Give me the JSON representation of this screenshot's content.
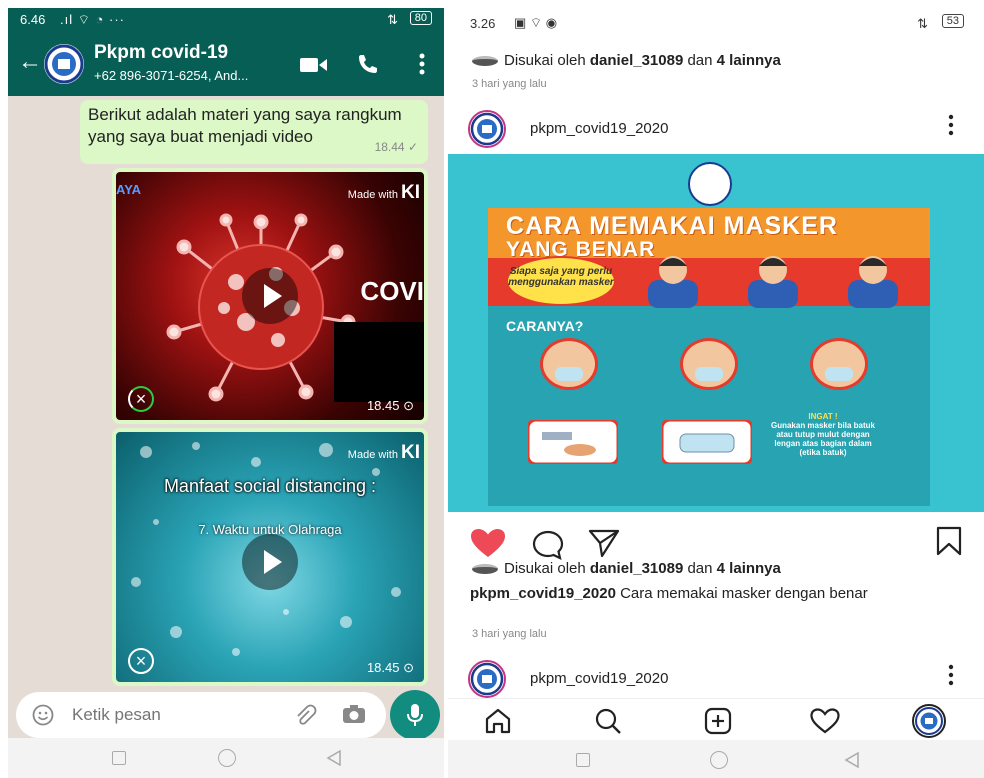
{
  "whatsapp": {
    "status": {
      "time": "6.46",
      "battery": "80"
    },
    "header": {
      "title": "Pkpm covid-19",
      "subtitle": "+62 896-3071-6254, And..."
    },
    "message": {
      "text": "Berikut adalah materi yang saya rangkum yang saya buat menjadi video",
      "time": "18.44 ✓"
    },
    "video1": {
      "watermark_small": "Made with",
      "watermark_big": "KI",
      "overlay_text": "COVI",
      "corner_text": "AYA",
      "time": "18.45 ⊙"
    },
    "video2": {
      "watermark_small": "Made with",
      "watermark_big": "KI",
      "title": "Manfaat social distancing :",
      "subtitle": "7. Waktu untuk Olahraga",
      "time": "18.45 ⊙"
    },
    "input": {
      "placeholder": "Ketik pesan"
    }
  },
  "instagram": {
    "status": {
      "time": "3.26",
      "battery": "53"
    },
    "likes_top": {
      "prefix": "Disukai oleh ",
      "user": "daniel_31089",
      "middle": " dan ",
      "others": "4 lainnya"
    },
    "ago_top": "3 hari yang lalu",
    "post": {
      "username": "pkpm_covid19_2020",
      "poster": {
        "title_line1": "CARA MEMAKAI MASKER",
        "title_line2": "YANG BENAR",
        "who": "Siapa saja yang perlu menggunakan masker",
        "caranya": "CARANYA?",
        "ingat_title": "INGAT !",
        "ingat_text": "Gunakan masker bila batuk atau tutup mulut dengan lengan atas bagian dalam (etika batuk)"
      },
      "likes": {
        "prefix": "Disukai oleh ",
        "user": "daniel_31089",
        "middle": " dan ",
        "others": "4 lainnya"
      },
      "caption_user": "pkpm_covid19_2020",
      "caption_text": " Cara memakai masker dengan benar",
      "ago": "3 hari yang lalu"
    },
    "next_post": {
      "username": "pkpm_covid19_2020"
    }
  },
  "colors": {
    "wa_green": "#075e54",
    "wa_bubble": "#dcf8c6",
    "wa_mic": "#128c7e",
    "ig_heart": "#ed4956"
  }
}
